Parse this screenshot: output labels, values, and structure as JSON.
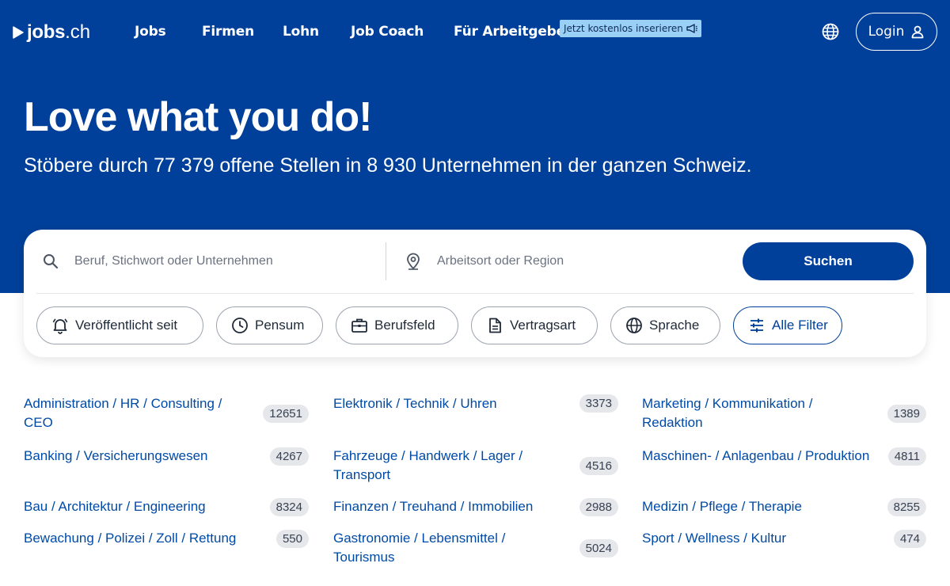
{
  "brand": {
    "name": "jobs",
    "tld": ".ch"
  },
  "nav": {
    "items": [
      {
        "label": "Jobs"
      },
      {
        "label": "Firmen"
      },
      {
        "label": "Lohn"
      },
      {
        "label": "Job Coach"
      },
      {
        "label": "Für Arbeitgeber"
      }
    ],
    "promo_label": "Jetzt kostenlos inserieren",
    "login_label": "Login"
  },
  "hero": {
    "title": "Love what you do!",
    "subtitle": "Stöbere durch 77 379 offene Stellen in 8 930 Unternehmen in der ganzen Schweiz."
  },
  "search": {
    "what_placeholder": "Beruf, Stichwort oder Unternehmen",
    "where_placeholder": "Arbeitsort oder Region",
    "submit_label": "Suchen"
  },
  "filters": [
    {
      "label": "Veröffentlicht seit",
      "icon": "bell-icon"
    },
    {
      "label": "Pensum",
      "icon": "clock-icon"
    },
    {
      "label": "Berufsfeld",
      "icon": "briefcase-icon"
    },
    {
      "label": "Vertragsart",
      "icon": "document-icon"
    },
    {
      "label": "Sprache",
      "icon": "globe-icon"
    },
    {
      "label": "Alle Filter",
      "icon": "sliders-icon"
    }
  ],
  "categories": [
    {
      "label": "Administration / HR / Consulting / CEO",
      "count": "12651"
    },
    {
      "label": "Banking / Versicherungswesen",
      "count": "4267"
    },
    {
      "label": "Bau / Architektur / Engineering",
      "count": "8324"
    },
    {
      "label": "Bewachung / Polizei / Zoll / Rettung",
      "count": "550"
    },
    {
      "label": "Elektronik / Technik / Uhren",
      "count": "3373"
    },
    {
      "label": "Fahrzeuge / Handwerk / Lager / Transport",
      "count": "4516"
    },
    {
      "label": "Finanzen / Treuhand / Immobilien",
      "count": "2988"
    },
    {
      "label": "Gastronomie / Lebensmittel / Tourismus",
      "count": "5024"
    },
    {
      "label": "Marketing / Kommunikation / Redaktion",
      "count": "1389"
    },
    {
      "label": "Maschinen- / Anlagenbau / Produktion",
      "count": "4811"
    },
    {
      "label": "Medizin / Pflege / Therapie",
      "count": "8255"
    },
    {
      "label": "Sport / Wellness / Kultur",
      "count": "474"
    }
  ],
  "colors": {
    "brand_blue": "#00409a",
    "promo_bg": "#9ad0f5",
    "link_blue": "#004aa6",
    "badge_bg": "#e5e7eb"
  }
}
